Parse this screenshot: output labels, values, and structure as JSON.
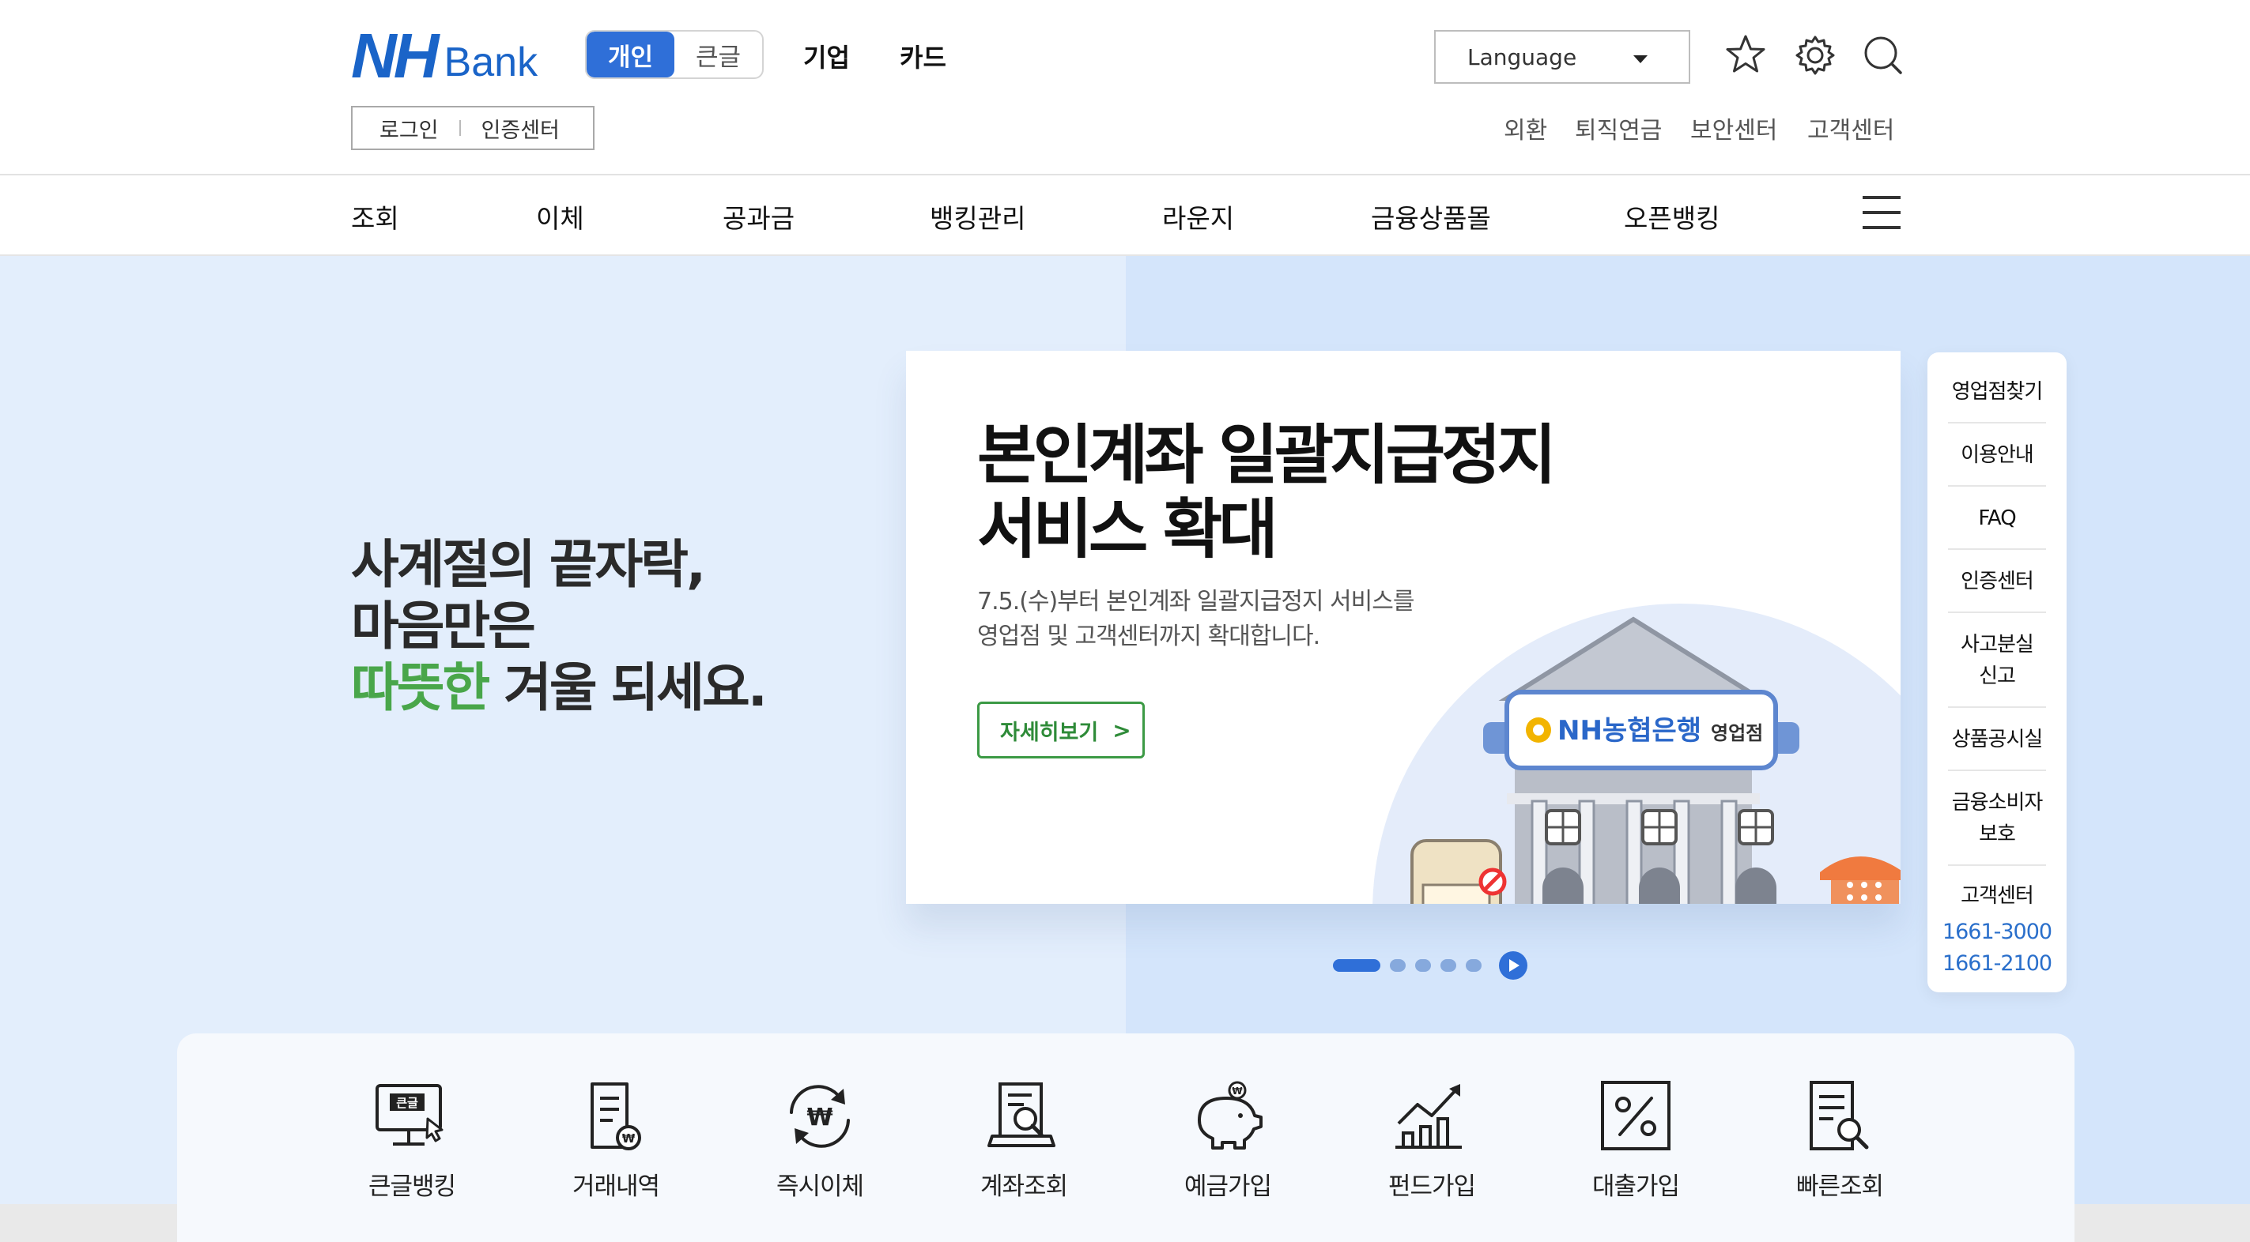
{
  "header": {
    "logo_nh": "NH",
    "logo_bank": "Bank",
    "mode_toggle": {
      "active": "개인",
      "inactive": "큰글"
    },
    "top_nav": [
      "기업",
      "카드"
    ],
    "language_label": "Language",
    "login_links": [
      "로그인",
      "인증센터"
    ],
    "util_links": [
      "외환",
      "퇴직연금",
      "보안센터",
      "고객센터"
    ],
    "icons": [
      "star-icon",
      "gear-icon",
      "search-icon"
    ]
  },
  "gnb": {
    "items": [
      "조회",
      "이체",
      "공과금",
      "뱅킹관리",
      "라운지",
      "금융상품몰",
      "오픈뱅킹"
    ]
  },
  "hero": {
    "tagline_line1": "사계절의 끝자락,",
    "tagline_line2": "마음만은",
    "tagline_highlight": "따뜻한",
    "tagline_line3_rest": " 겨울 되세요.",
    "slide": {
      "title_line1": "본인계좌 일괄지급정지",
      "title_line2": "서비스 확대",
      "desc_line1": "7.5.(수)부터 본인계좌 일괄지급정지 서비스를",
      "desc_line2": "영업점 및 고객센터까지 확대합니다.",
      "button_label": "자세히보기",
      "button_chevron": ">",
      "sign_text": "NH농협은행",
      "sign_sub": "영업점"
    },
    "carousel": {
      "total": 5,
      "active_index": 0
    }
  },
  "quick_menu": {
    "items": [
      "영업점찾기",
      "이용안내",
      "FAQ",
      "인증센터",
      "사고분실\n신고",
      "상품공시실",
      "금융소비자\n보호",
      "고객센터"
    ],
    "phones": [
      "1661-3000",
      "1661-2100"
    ]
  },
  "services": {
    "items": [
      "큰글뱅킹",
      "거래내역",
      "즉시이체",
      "계좌조회",
      "예금가입",
      "펀드가입",
      "대출가입",
      "빠른조회"
    ],
    "icons": [
      "monitor-icon",
      "document-won-icon",
      "refresh-won-icon",
      "account-search-icon",
      "piggy-bank-icon",
      "chart-icon",
      "percent-icon",
      "document-search-icon"
    ],
    "monitor_badge": "큰글"
  },
  "colors": {
    "brand_blue": "#2f6fd8",
    "green": "#49a64a",
    "hero_bg_left": "#e3eefc",
    "hero_bg_right": "#d4e5fb"
  }
}
